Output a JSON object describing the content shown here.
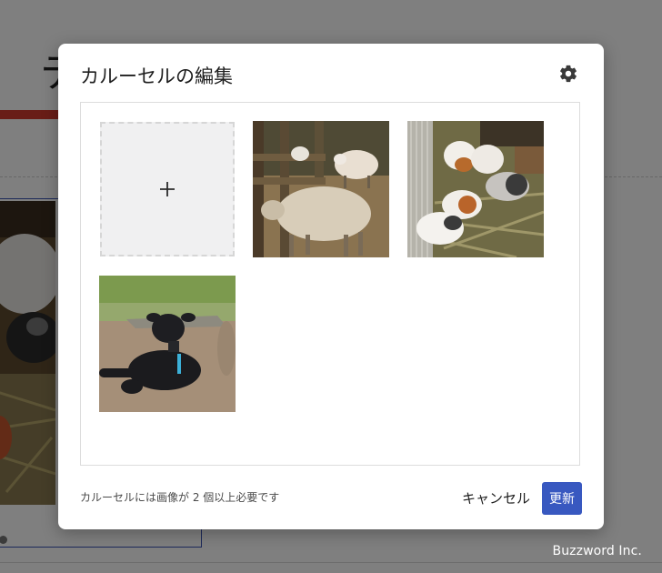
{
  "background": {
    "title_glyph": "テ",
    "watermark": "Buzzword Inc."
  },
  "modal": {
    "title": "カルーセルの編集",
    "settings_icon": "gear-icon",
    "add_icon": "plus-icon",
    "add_glyph": "+",
    "images": [
      {
        "subject": "sheep-at-fence"
      },
      {
        "subject": "guinea-pigs-in-pen"
      },
      {
        "subject": "black-lamb-lying"
      }
    ],
    "hint": "カルーセルには画像が 2 個以上必要です",
    "cancel_label": "キャンセル",
    "update_label": "更新",
    "accent_color": "#3858c0"
  }
}
